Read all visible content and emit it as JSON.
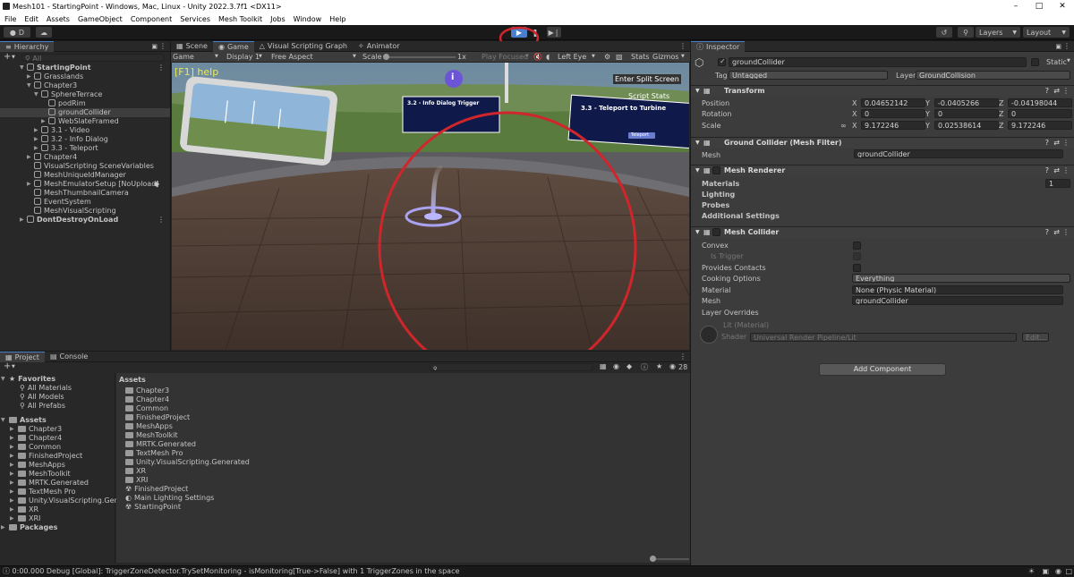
{
  "window": {
    "title": "Mesh101 - StartingPoint - Windows, Mac, Linux - Unity 2022.3.7f1 <DX11>"
  },
  "menu": [
    "File",
    "Edit",
    "Assets",
    "GameObject",
    "Component",
    "Services",
    "Mesh Toolkit",
    "Jobs",
    "Window",
    "Help"
  ],
  "toolbar": {
    "account": "D",
    "layers": "Layers",
    "layout": "Layout"
  },
  "hierarchy": {
    "tab": "Hierarchy",
    "search_placeholder": "All",
    "items": [
      {
        "label": "StartingPoint",
        "depth": 0
      },
      {
        "label": "Grasslands",
        "depth": 1
      },
      {
        "label": "Chapter3",
        "depth": 1
      },
      {
        "label": "SphereTerrace",
        "depth": 2
      },
      {
        "label": "podRim",
        "depth": 3
      },
      {
        "label": "groundCollider",
        "depth": 3
      },
      {
        "label": "WebSlateFramed",
        "depth": 3
      },
      {
        "label": "3.1 - Video",
        "depth": 2
      },
      {
        "label": "3.2 - Info Dialog",
        "depth": 2
      },
      {
        "label": "3.3 - Teleport",
        "depth": 2
      },
      {
        "label": "Chapter4",
        "depth": 1
      },
      {
        "label": "VisualScripting SceneVariables",
        "depth": 1
      },
      {
        "label": "MeshUniqueIdManager",
        "depth": 1
      },
      {
        "label": "MeshEmulatorSetup [NoUpload]",
        "depth": 1
      },
      {
        "label": "MeshThumbnailCamera",
        "depth": 1
      },
      {
        "label": "EventSystem",
        "depth": 1
      },
      {
        "label": "MeshVisualScripting",
        "depth": 1
      },
      {
        "label": "DontDestroyOnLoad",
        "depth": 0
      }
    ]
  },
  "game": {
    "tabs": [
      "Scene",
      "Game",
      "Visual Scripting Graph",
      "Animator"
    ],
    "display_mode": "Game",
    "display": "Display 1",
    "aspect": "Free Aspect",
    "scale_label": "Scale",
    "scale_value": "1x",
    "play_focused": "Play Focused",
    "eye": "Left Eye",
    "stats": "Stats",
    "gizmos": "Gizmos",
    "help": "[F1] help",
    "split": "Enter Split Screen",
    "script_stats": "Script Stats",
    "sign1_title": "3.2 - Info Dialog Trigger",
    "sign2_title": "3.3 - Teleport to Turbine",
    "sign2_button": "Teleport"
  },
  "project": {
    "tabs": [
      "Project",
      "Console"
    ],
    "favorites_label": "Favorites",
    "favorites": [
      "All Materials",
      "All Models",
      "All Prefabs"
    ],
    "assets_label": "Assets",
    "asset_tree": [
      "Chapter3",
      "Chapter4",
      "Common",
      "FinishedProject",
      "MeshApps",
      "MeshToolkit",
      "MRTK.Generated",
      "TextMesh Pro",
      "Unity.VisualScripting.Genera",
      "XR",
      "XRI"
    ],
    "packages_label": "Packages",
    "breadcrumb": "Assets",
    "files": [
      "Chapter3",
      "Chapter4",
      "Common",
      "FinishedProject",
      "MeshApps",
      "MeshToolkit",
      "MRTK.Generated",
      "TextMesh Pro",
      "Unity.VisualScripting.Generated",
      "XR",
      "XRI",
      "FinishedProject",
      "Main Lighting Settings",
      "StartingPoint"
    ],
    "count": "28"
  },
  "inspector": {
    "tab": "Inspector",
    "name": "groundCollider",
    "static": "Static",
    "tag_label": "Tag",
    "tag": "Untagged",
    "layer_label": "Layer",
    "layer": "GroundCollision",
    "transform": "Transform",
    "position_label": "Position",
    "pos": [
      "0.04652142",
      "-0.0405266",
      "-0.04198044"
    ],
    "rotation_label": "Rotation",
    "rot": [
      "0",
      "0",
      "0"
    ],
    "scale_label": "Scale",
    "scl": [
      "9.172246",
      "0.02538614",
      "9.172246"
    ],
    "mesh_filter": "Ground Collider (Mesh Filter)",
    "mesh_label": "Mesh",
    "mesh_value": "groundCollider",
    "renderer": "Mesh Renderer",
    "materials": "Materials",
    "materials_count": "1",
    "lighting": "Lighting",
    "probes": "Probes",
    "additional": "Additional Settings",
    "collider": "Mesh Collider",
    "convex": "Convex",
    "is_trigger": "Is Trigger",
    "provides_contacts": "Provides Contacts",
    "cooking_label": "Cooking Options",
    "cooking_value": "Everything",
    "material_label": "Material",
    "material_value": "None (Physic Material)",
    "collider_mesh_label": "Mesh",
    "collider_mesh_value": "groundCollider",
    "layer_overrides": "Layer Overrides",
    "lit_material": "Lit (Material)",
    "shader_label": "Shader",
    "shader_value": "Universal Render Pipeline/Lit",
    "edit": "Edit...",
    "add_component": "Add Component"
  },
  "status": {
    "message": "0:00.000 Debug [Global]: TriggerZoneDetector.TrySetMonitoring - isMonitoring[True->False] with 1 TriggerZones in the space"
  },
  "colors": {
    "highlight": "#d0262b",
    "accent": "#4a7fce"
  }
}
